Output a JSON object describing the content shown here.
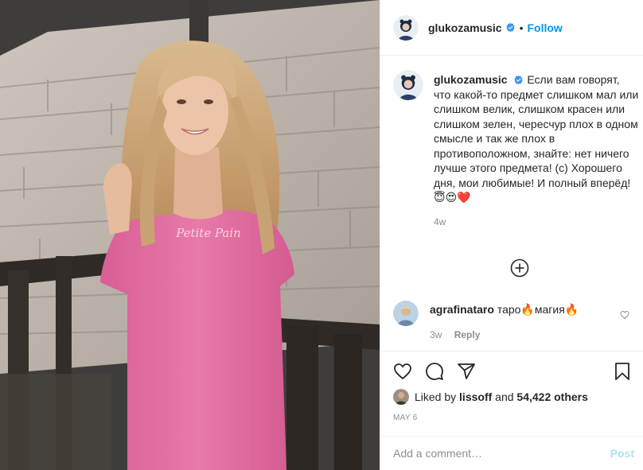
{
  "header": {
    "username": "glukozamusic",
    "separator": "•",
    "follow_label": "Follow"
  },
  "caption": {
    "username": "glukozamusic",
    "text": "Если вам говорят, что какой-то предмет слишком мал или слишком велик, слишком красен или слишком зелен, чересчур плох в одном смысле и так же плох в противоположном, знайте: нет ничего лучше этого предмета! (с) Хорошего дня, мои любимые! И полный вперёд! 😇😍❤️",
    "age": "4w"
  },
  "comment": {
    "username": "agrafinataro",
    "text": "таро🔥магия🔥",
    "age": "3w",
    "reply_label": "Reply"
  },
  "likes": {
    "prefix": "Liked by",
    "liker": "lissoff",
    "and": "and",
    "count": "54,422 others"
  },
  "date": "MAY 6",
  "add_comment": {
    "placeholder": "Add a comment…",
    "post_label": "Post"
  },
  "photo": {
    "shirt_print": "Petite Pain"
  },
  "colors": {
    "accent": "#0095f6",
    "post_disabled": "#b2dffc",
    "shirt": "#e46fa1",
    "text": "#262626",
    "muted": "#8e8e8e"
  }
}
